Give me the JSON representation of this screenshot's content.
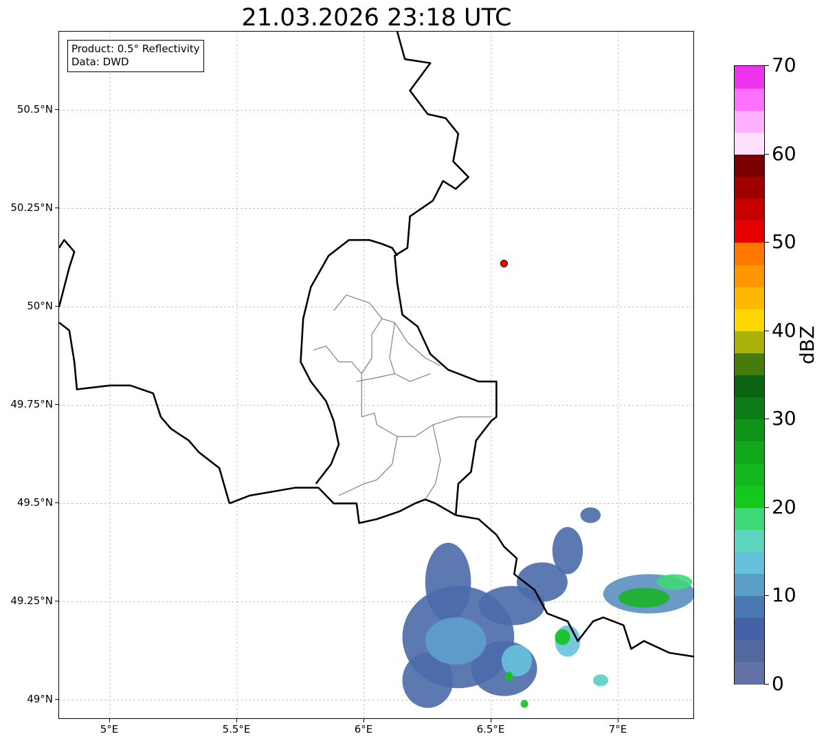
{
  "title": "21.03.2026 23:18 UTC",
  "info": {
    "product_label": "Product: 0.5° Reflectivity",
    "data_label": "Data: DWD"
  },
  "map": {
    "extent": {
      "lon": [
        4.8,
        7.3
      ],
      "lat": [
        48.95,
        50.7
      ]
    },
    "lon_ticks": [
      {
        "value": 5.0,
        "label": "5°E"
      },
      {
        "value": 5.5,
        "label": "5.5°E"
      },
      {
        "value": 6.0,
        "label": "6°E"
      },
      {
        "value": 6.5,
        "label": "6.5°E"
      },
      {
        "value": 7.0,
        "label": "7°E"
      }
    ],
    "lat_ticks": [
      {
        "value": 50.5,
        "label": "50.5°N"
      },
      {
        "value": 50.25,
        "label": "50.25°N"
      },
      {
        "value": 50.0,
        "label": "50°N"
      },
      {
        "value": 49.75,
        "label": "49.75°N"
      },
      {
        "value": 49.5,
        "label": "49.5°N"
      },
      {
        "value": 49.25,
        "label": "49.25°N"
      },
      {
        "value": 49.0,
        "label": "49°N"
      }
    ],
    "radar_site": {
      "lon": 6.55,
      "lat": 50.11,
      "color": "#ff0000"
    },
    "borders": [
      [
        [
          6.13,
          50.7
        ],
        [
          6.16,
          50.63
        ],
        [
          6.26,
          50.62
        ],
        [
          6.18,
          50.55
        ],
        [
          6.25,
          50.49
        ],
        [
          6.32,
          50.48
        ],
        [
          6.37,
          50.44
        ],
        [
          6.35,
          50.37
        ],
        [
          6.41,
          50.33
        ],
        [
          6.36,
          50.3
        ],
        [
          6.31,
          50.32
        ],
        [
          6.27,
          50.27
        ],
        [
          6.18,
          50.23
        ],
        [
          6.17,
          50.15
        ],
        [
          6.12,
          50.13
        ],
        [
          6.13,
          50.06
        ],
        [
          6.15,
          49.98
        ],
        [
          6.21,
          49.95
        ],
        [
          6.26,
          49.88
        ],
        [
          6.33,
          49.84
        ],
        [
          6.45,
          49.81
        ],
        [
          6.52,
          49.81
        ],
        [
          6.52,
          49.72
        ],
        [
          6.5,
          49.71
        ],
        [
          6.44,
          49.66
        ],
        [
          6.42,
          49.58
        ],
        [
          6.37,
          49.55
        ],
        [
          6.36,
          49.47
        ]
      ],
      [
        [
          6.36,
          49.47
        ],
        [
          6.45,
          49.46
        ],
        [
          6.52,
          49.42
        ],
        [
          6.55,
          49.39
        ],
        [
          6.6,
          49.36
        ],
        [
          6.59,
          49.32
        ],
        [
          6.67,
          49.28
        ],
        [
          6.72,
          49.22
        ],
        [
          6.8,
          49.2
        ],
        [
          6.84,
          49.15
        ],
        [
          6.9,
          49.2
        ],
        [
          6.94,
          49.21
        ],
        [
          7.02,
          49.19
        ],
        [
          7.05,
          49.13
        ],
        [
          7.1,
          49.15
        ],
        [
          7.2,
          49.12
        ],
        [
          7.3,
          49.11
        ]
      ],
      [
        [
          6.36,
          49.47
        ],
        [
          6.28,
          49.5
        ],
        [
          6.24,
          49.51
        ],
        [
          6.2,
          49.5
        ],
        [
          6.14,
          49.48
        ],
        [
          6.05,
          49.46
        ],
        [
          5.98,
          49.45
        ],
        [
          5.97,
          49.5
        ],
        [
          5.88,
          49.5
        ],
        [
          5.82,
          49.54
        ],
        [
          5.73,
          49.54
        ],
        [
          5.64,
          49.53
        ],
        [
          5.55,
          49.52
        ],
        [
          5.47,
          49.5
        ]
      ],
      [
        [
          5.47,
          49.5
        ],
        [
          5.43,
          49.59
        ],
        [
          5.35,
          49.63
        ],
        [
          5.31,
          49.66
        ],
        [
          5.24,
          49.69
        ],
        [
          5.2,
          49.72
        ],
        [
          5.17,
          49.78
        ],
        [
          5.08,
          49.8
        ],
        [
          5.0,
          49.8
        ],
        [
          4.87,
          49.79
        ],
        [
          4.86,
          49.86
        ],
        [
          4.84,
          49.94
        ],
        [
          4.8,
          49.96
        ]
      ],
      [
        [
          5.81,
          49.55
        ],
        [
          5.87,
          49.6
        ],
        [
          5.9,
          49.65
        ],
        [
          5.88,
          49.71
        ],
        [
          5.85,
          49.76
        ],
        [
          5.79,
          49.81
        ],
        [
          5.75,
          49.86
        ],
        [
          5.76,
          49.97
        ],
        [
          5.79,
          50.05
        ],
        [
          5.86,
          50.13
        ],
        [
          5.94,
          50.17
        ],
        [
          6.02,
          50.17
        ],
        [
          6.07,
          50.16
        ],
        [
          6.11,
          50.15
        ],
        [
          6.13,
          50.13
        ]
      ],
      [
        [
          4.8,
          50.15
        ],
        [
          4.82,
          50.17
        ],
        [
          4.86,
          50.14
        ],
        [
          4.84,
          50.1
        ],
        [
          4.82,
          50.05
        ],
        [
          4.8,
          50.0
        ]
      ]
    ],
    "provinces": [
      [
        [
          5.88,
          49.99
        ],
        [
          5.93,
          50.03
        ],
        [
          6.02,
          50.01
        ],
        [
          6.07,
          49.97
        ],
        [
          6.12,
          49.96
        ],
        [
          6.17,
          49.91
        ],
        [
          6.24,
          49.87
        ],
        [
          6.3,
          49.85
        ]
      ],
      [
        [
          5.8,
          49.89
        ],
        [
          5.85,
          49.9
        ],
        [
          5.9,
          49.86
        ],
        [
          5.95,
          49.86
        ],
        [
          5.99,
          49.83
        ],
        [
          6.03,
          49.87
        ],
        [
          6.03,
          49.93
        ],
        [
          6.07,
          49.97
        ]
      ],
      [
        [
          5.97,
          49.81
        ],
        [
          6.05,
          49.82
        ],
        [
          6.12,
          49.83
        ],
        [
          6.18,
          49.81
        ],
        [
          6.26,
          49.83
        ]
      ],
      [
        [
          5.99,
          49.72
        ],
        [
          6.04,
          49.73
        ],
        [
          6.05,
          49.7
        ],
        [
          6.13,
          49.67
        ],
        [
          6.2,
          49.67
        ],
        [
          6.27,
          49.7
        ],
        [
          6.37,
          49.72
        ],
        [
          6.5,
          49.72
        ]
      ],
      [
        [
          6.13,
          49.67
        ],
        [
          6.11,
          49.6
        ],
        [
          6.05,
          49.56
        ],
        [
          6.0,
          49.55
        ],
        [
          5.9,
          49.52
        ]
      ],
      [
        [
          6.27,
          49.7
        ],
        [
          6.3,
          49.61
        ],
        [
          6.28,
          49.55
        ],
        [
          6.24,
          49.51
        ]
      ],
      [
        [
          6.03,
          49.87
        ],
        [
          5.99,
          49.83
        ],
        [
          5.99,
          49.72
        ]
      ],
      [
        [
          6.12,
          49.96
        ],
        [
          6.1,
          49.87
        ],
        [
          6.12,
          49.83
        ]
      ]
    ],
    "radar_blobs": [
      {
        "lon": 6.37,
        "lat": 49.16,
        "rx": 0.22,
        "ry": 0.13,
        "color": "#4a6aaa"
      },
      {
        "lon": 6.33,
        "lat": 49.3,
        "rx": 0.09,
        "ry": 0.1,
        "color": "#4a6aaa"
      },
      {
        "lon": 6.25,
        "lat": 49.05,
        "rx": 0.1,
        "ry": 0.07,
        "color": "#4a6aaa"
      },
      {
        "lon": 6.58,
        "lat": 49.24,
        "rx": 0.13,
        "ry": 0.05,
        "color": "#4a6aaa"
      },
      {
        "lon": 6.7,
        "lat": 49.3,
        "rx": 0.1,
        "ry": 0.05,
        "color": "#4a6aaa"
      },
      {
        "lon": 6.55,
        "lat": 49.08,
        "rx": 0.13,
        "ry": 0.07,
        "color": "#4a6aaa"
      },
      {
        "lon": 6.8,
        "lat": 49.38,
        "rx": 0.06,
        "ry": 0.06,
        "color": "#4a6aaa"
      },
      {
        "lon": 6.89,
        "lat": 49.47,
        "rx": 0.04,
        "ry": 0.02,
        "color": "#4a6aaa"
      },
      {
        "lon": 7.12,
        "lat": 49.27,
        "rx": 0.18,
        "ry": 0.05,
        "color": "#5a8fbf"
      },
      {
        "lon": 6.36,
        "lat": 49.15,
        "rx": 0.12,
        "ry": 0.06,
        "color": "#5f9fcc"
      },
      {
        "lon": 6.6,
        "lat": 49.1,
        "rx": 0.06,
        "ry": 0.04,
        "color": "#66c2dc"
      },
      {
        "lon": 6.8,
        "lat": 49.15,
        "rx": 0.05,
        "ry": 0.04,
        "color": "#66c2dc"
      },
      {
        "lon": 6.78,
        "lat": 49.16,
        "rx": 0.03,
        "ry": 0.02,
        "color": "#14c21e"
      },
      {
        "lon": 7.1,
        "lat": 49.26,
        "rx": 0.1,
        "ry": 0.025,
        "color": "#1ab426"
      },
      {
        "lon": 7.22,
        "lat": 49.3,
        "rx": 0.07,
        "ry": 0.02,
        "color": "#3ed878"
      },
      {
        "lon": 6.93,
        "lat": 49.05,
        "rx": 0.03,
        "ry": 0.015,
        "color": "#58d2c0"
      },
      {
        "lon": 6.57,
        "lat": 49.06,
        "rx": 0.015,
        "ry": 0.012,
        "color": "#14c21e"
      },
      {
        "lon": 6.63,
        "lat": 48.99,
        "rx": 0.015,
        "ry": 0.01,
        "color": "#14c21e"
      }
    ]
  },
  "colorbar": {
    "label": "dBZ",
    "min": 0,
    "max": 70,
    "ticks": [
      "0",
      "10",
      "20",
      "30",
      "40",
      "50",
      "60",
      "70"
    ],
    "colors": [
      "#6272a6",
      "#5468a0",
      "#4561a8",
      "#4a78b2",
      "#5a9ec8",
      "#64c0dc",
      "#5cd4c0",
      "#3ed878",
      "#14c81e",
      "#12b81c",
      "#10a81a",
      "#0e9318",
      "#0c7c16",
      "#0a6412",
      "#467c0c",
      "#aab20a",
      "#ffd700",
      "#ffb800",
      "#ff9600",
      "#ff7800",
      "#e60000",
      "#c80000",
      "#a00000",
      "#7a0000",
      "#ffe0ff",
      "#ffb0ff",
      "#ff70ff",
      "#ee33ee"
    ]
  }
}
